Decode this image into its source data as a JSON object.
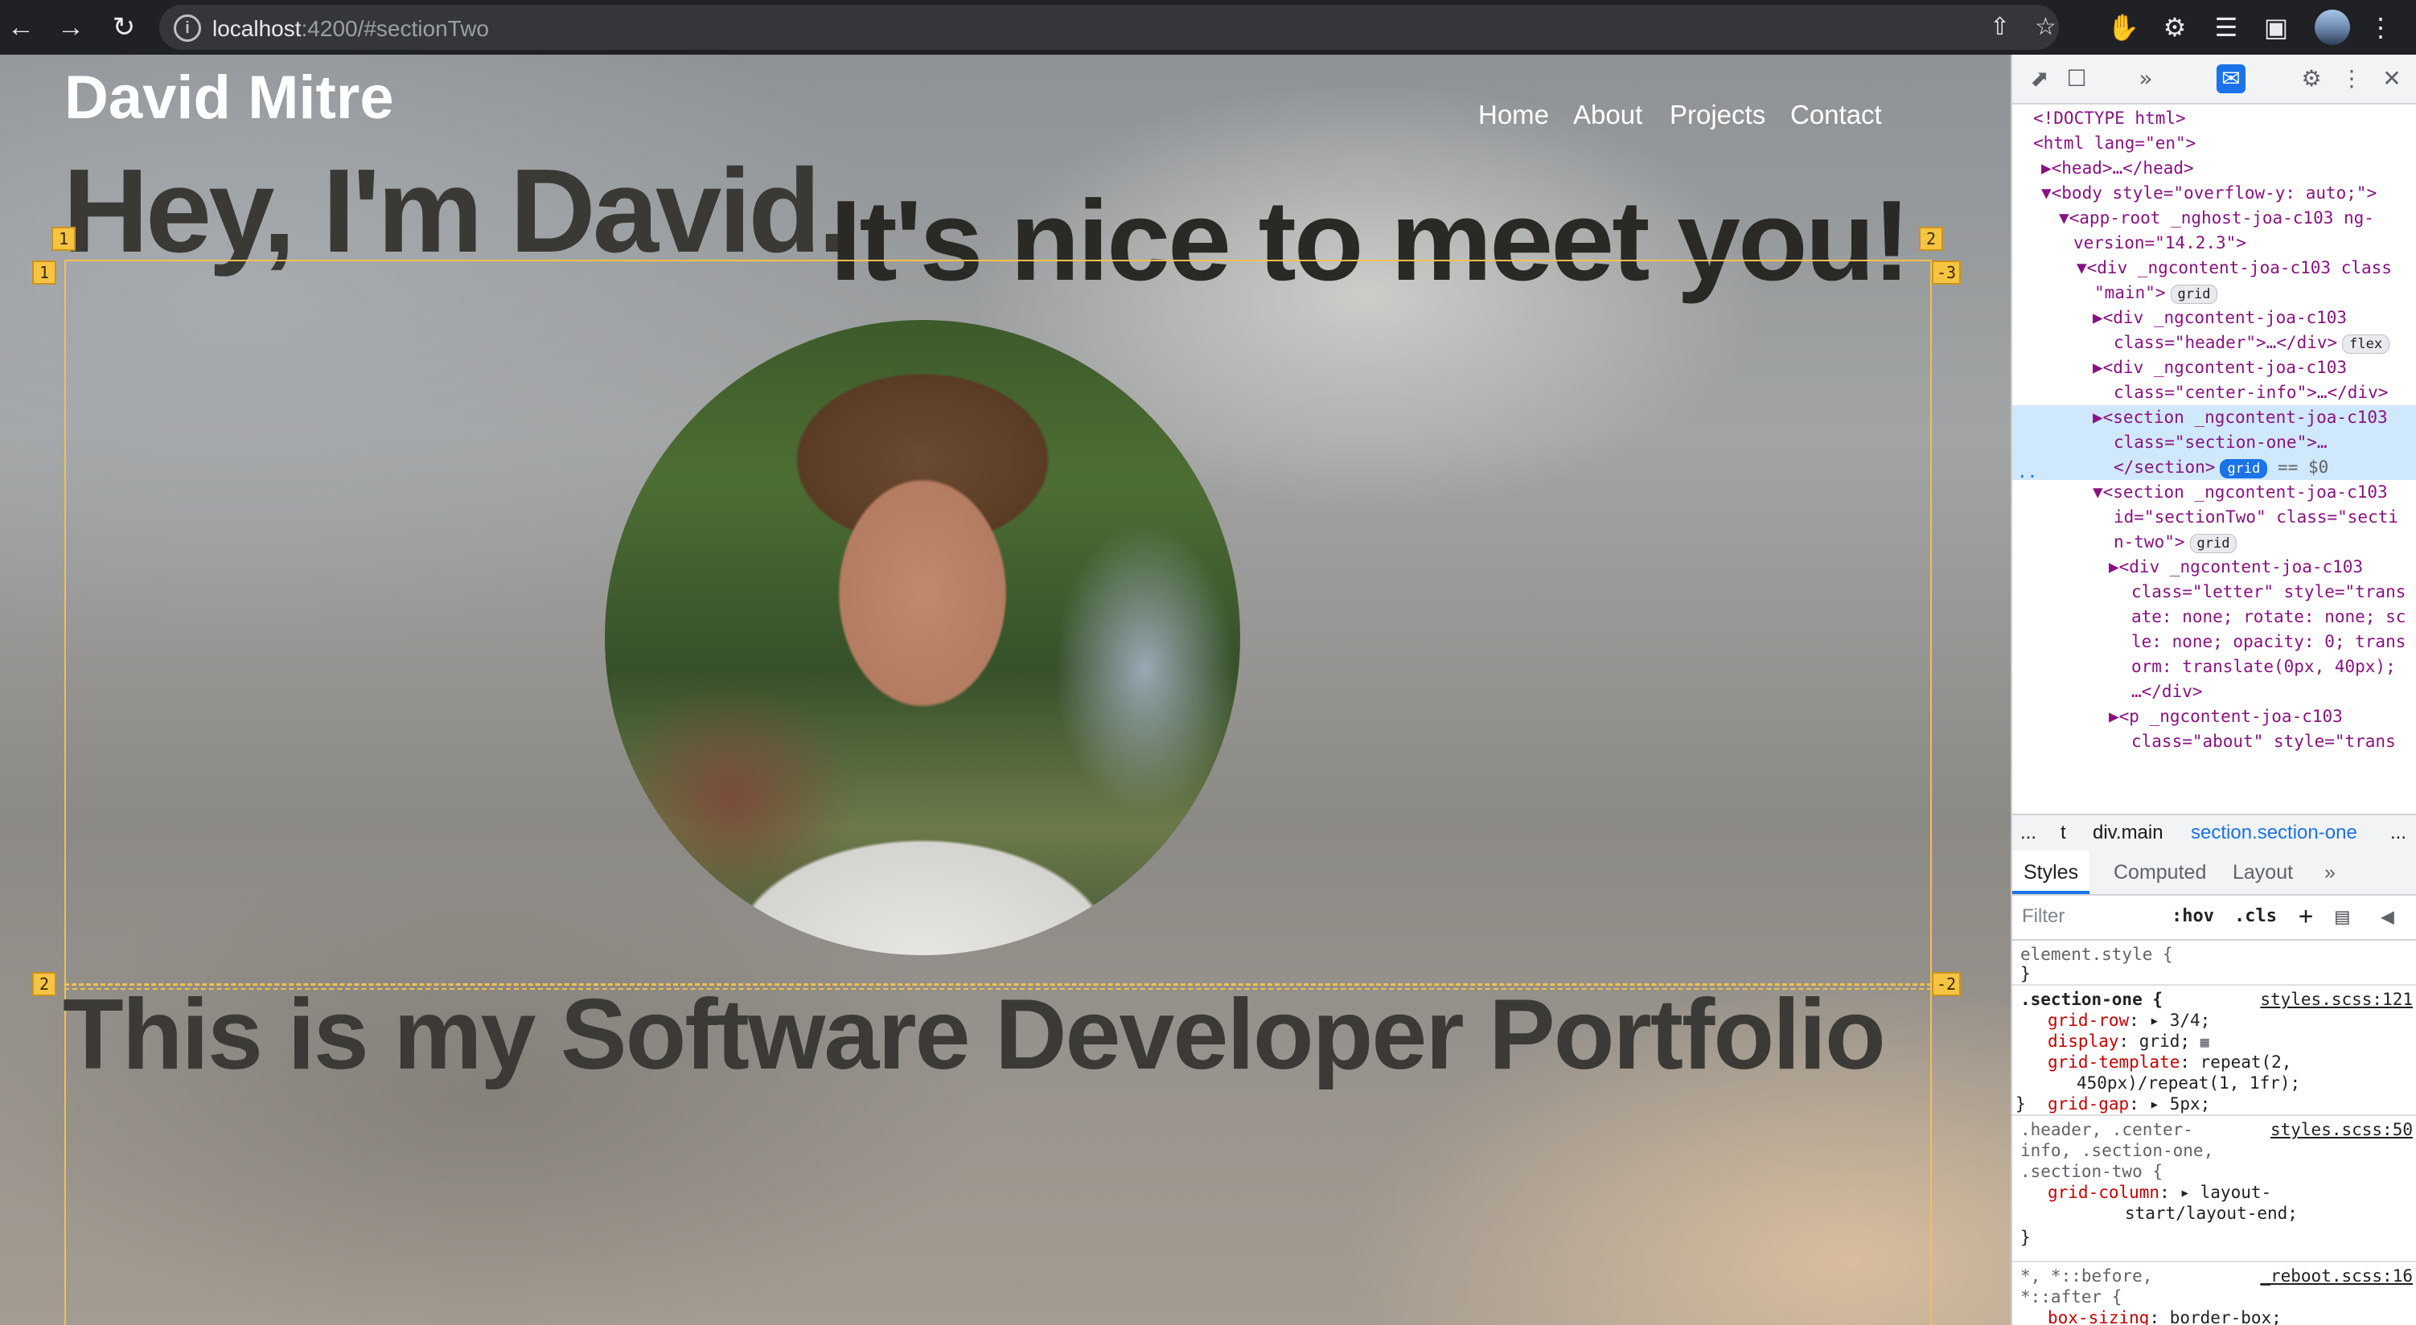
{
  "browser": {
    "url_host": "localhost",
    "url_path": ":4200/#sectionTwo"
  },
  "page": {
    "site_title": "David Mitre",
    "nav": [
      "Home",
      "About",
      "Projects",
      "Contact"
    ],
    "heading_hey": "Hey, I'm David.",
    "heading_nice": "It's nice to meet you!",
    "heading_portfolio": "This is my Software Developer Portfolio",
    "grid_badges": [
      "1",
      "2",
      "1",
      "-3",
      "2",
      "-2"
    ]
  },
  "devtools": {
    "dom_lines": [
      "<!DOCTYPE html>",
      "<html lang=\"en\">",
      "▶<head>…</head>",
      "▼<body style=\"overflow-y: auto;\">",
      "▼<app-root _nghost-joa-c103 ng-",
      "version=\"14.2.3\">",
      "▼<div _ngcontent-joa-c103 class",
      "\"main\">",
      "▶<div _ngcontent-joa-c103",
      "class=\"header\">…</div>",
      "▶<div _ngcontent-joa-c103",
      "class=\"center-info\">…</div>",
      "▶<section _ngcontent-joa-c103",
      "class=\"section-one\">…",
      "</section>",
      "▼<section _ngcontent-joa-c103",
      "id=\"sectionTwo\" class=\"secti",
      "n-two\">",
      "▶<div _ngcontent-joa-c103",
      "class=\"letter\" style=\"trans",
      "ate: none; rotate: none; sc",
      "le: none; opacity: 0; trans",
      "orm: translate(0px, 40px);",
      "…</div>",
      "▶<p _ngcontent-joa-c103",
      "class=\"about\" style=\"trans"
    ],
    "badges": {
      "grid": "grid",
      "flex": "flex",
      "eq": "== $0",
      "dots": "..."
    },
    "breadcrumb": [
      "...",
      "t",
      "div.main",
      "section.section-one",
      "..."
    ],
    "tabs": [
      "Styles",
      "Computed",
      "Layout",
      "»"
    ],
    "filter_placeholder": "Filter",
    "filter_tools": [
      ":hov",
      ".cls",
      "+"
    ],
    "rules": [
      {
        "selector": "element.style {",
        "source": "",
        "props": [],
        "close": "}"
      },
      {
        "selector": ".section-one {",
        "source": "styles.scss:121",
        "props": [
          {
            "name": "grid-row",
            "value": ": ▸ 3/4;"
          },
          {
            "name": "display",
            "value": ": grid;"
          },
          {
            "name": "grid-template",
            "value": ": repeat(2,"
          },
          {
            "name": "",
            "value": "450px)/repeat(1, 1fr);"
          },
          {
            "name": "grid-gap",
            "value": ": ▸ 5px;"
          }
        ],
        "close": "}"
      },
      {
        "selector": ".header, .center-",
        "source": "styles.scss:50",
        "props": [
          {
            "name": "",
            "value": "info, .section-one,"
          },
          {
            "name": "",
            "value": ".section-two {"
          },
          {
            "name": "grid-column",
            "value": ": ▸ layout-"
          },
          {
            "name": "",
            "value": "start/layout-end;"
          }
        ],
        "close": "}"
      },
      {
        "selector": "*, *::before,",
        "source": "_reboot.scss:16",
        "props": [
          {
            "name": "",
            "value": "*::after {"
          },
          {
            "name": "box-sizing",
            "value": ": border-box;"
          }
        ],
        "close": ""
      }
    ]
  }
}
